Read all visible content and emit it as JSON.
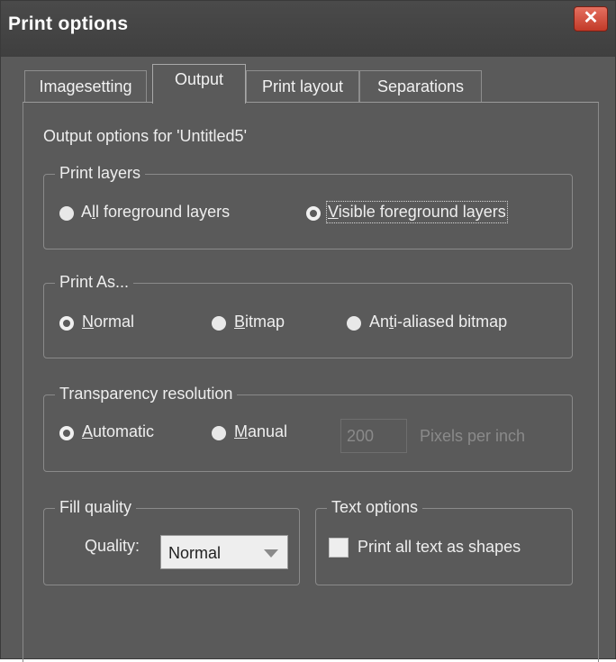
{
  "window": {
    "title": "Print options"
  },
  "tabs": [
    {
      "label": "Imagesetting"
    },
    {
      "label": "Output"
    },
    {
      "label": "Print layout"
    },
    {
      "label": "Separations"
    }
  ],
  "output_for_label": "Output options for  'Untitled5'",
  "print_layers": {
    "legend": "Print layers",
    "all_pre": "A",
    "all_key": "l",
    "all_post": "l foreground layers",
    "visible_key": "V",
    "visible_post": "isible foreground layers",
    "selected": "Visible foreground layers"
  },
  "print_as": {
    "legend": "Print As...",
    "normal_key": "N",
    "normal_post": "ormal",
    "bitmap_key": "B",
    "bitmap_post": "itmap",
    "aa_pre": "An",
    "aa_key": "t",
    "aa_post": "i-aliased bitmap",
    "selected": "Normal"
  },
  "transparency": {
    "legend": "Transparency resolution",
    "auto_key": "A",
    "auto_post": "utomatic",
    "manual_key": "M",
    "manual_post": "anual",
    "value": "200",
    "unit": "Pixels per inch",
    "selected": "Automatic"
  },
  "fill_quality": {
    "legend": "Fill quality",
    "label": "Quality:",
    "value": "Normal"
  },
  "text_options": {
    "legend": "Text options",
    "checkbox_label": "Print all text as shapes",
    "checked": false
  }
}
